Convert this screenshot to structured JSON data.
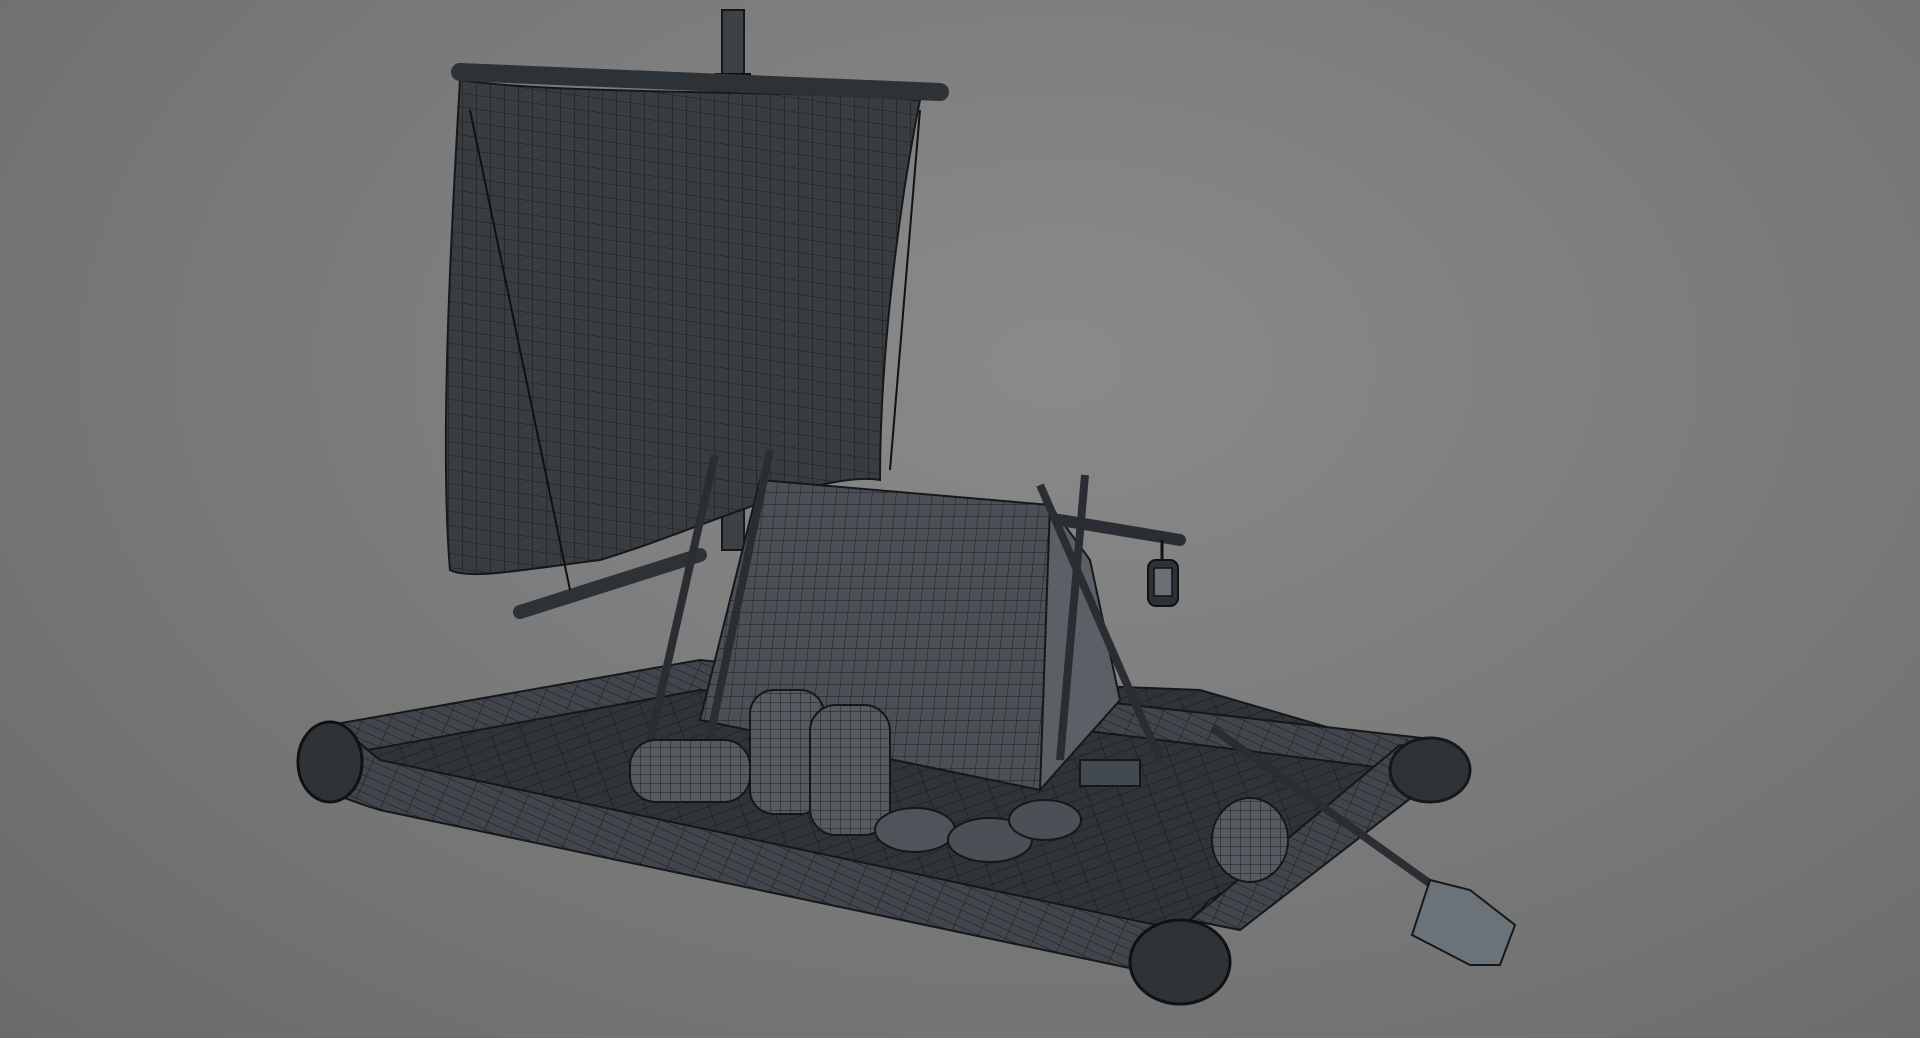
{
  "viewport": {
    "background_color": "#7d7d7d",
    "mesh_color": "#2e3236",
    "wire_color": "#15181a",
    "highlight_color": "#9aa3a8"
  },
  "scene": {
    "objects": [
      "raft-wireframe-model",
      "square-sail",
      "mast",
      "tent",
      "barrels",
      "hanging-lantern",
      "oar",
      "sacks"
    ]
  }
}
